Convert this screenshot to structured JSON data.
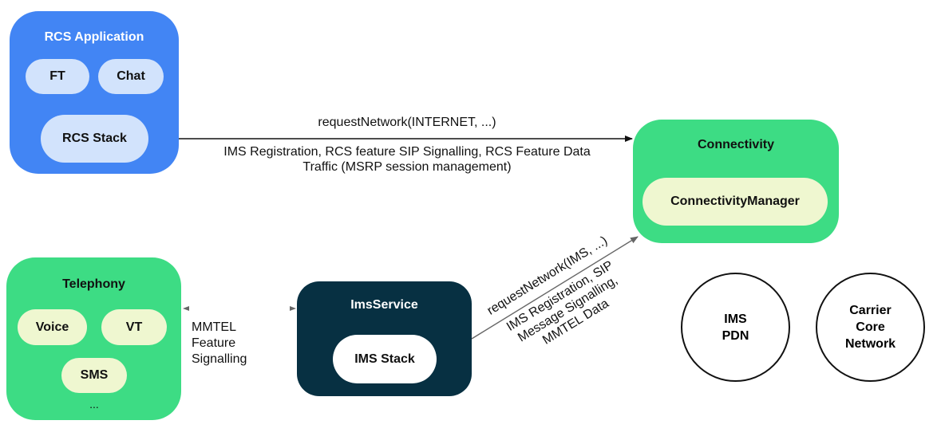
{
  "diagram": {
    "colors": {
      "rcs_box": "#4285f4",
      "rcs_pill": "#d2e3fc",
      "green_box": "#3ddc84",
      "green_pill": "#eff7d0",
      "ims_box": "#073042",
      "ims_pill": "#ffffff",
      "arrow_dark": "#111111",
      "arrow_gray": "#666666"
    },
    "rcs_application": {
      "title": "RCS Application",
      "components": [
        "FT",
        "Chat"
      ],
      "stack": "RCS Stack"
    },
    "telephony": {
      "title": "Telephony",
      "components": [
        "Voice",
        "VT",
        "SMS"
      ],
      "more": "..."
    },
    "ims_service": {
      "title": "ImsService",
      "stack": "IMS Stack"
    },
    "connectivity": {
      "title": "Connectivity",
      "manager": "ConnectivityManager"
    },
    "networks": {
      "ims_pdn": [
        "IMS",
        "PDN"
      ],
      "carrier_core": [
        "Carrier",
        "Core",
        "Network"
      ]
    },
    "edges": {
      "rcs_to_connectivity": {
        "top_label": "requestNetwork(INTERNET, ...)",
        "bottom_label": [
          "IMS Registration, RCS feature SIP Signalling, RCS Feature Data",
          "Traffic (MSRP session management)"
        ]
      },
      "telephony_ims": {
        "label": [
          "MMTEL",
          "Feature",
          "Signalling"
        ]
      },
      "ims_to_connectivity": {
        "top_label": "requestNetwork(IMS, ...)",
        "bottom_label": [
          "IMS Registration, SIP",
          "Message Signalling,",
          "MMTEL Data"
        ]
      }
    }
  }
}
